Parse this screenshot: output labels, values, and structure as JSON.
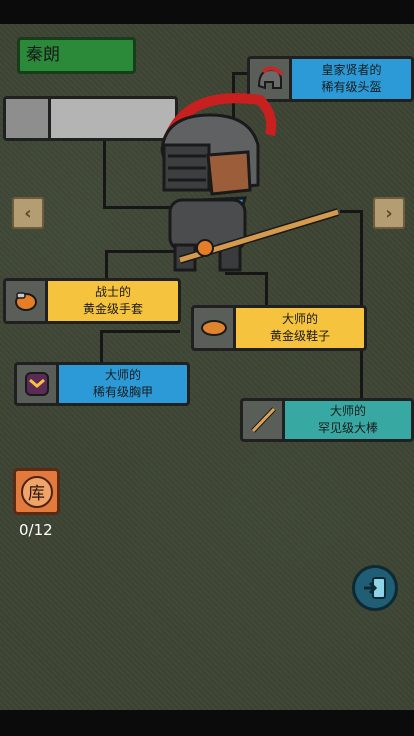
{
  "character": {
    "name": "秦朗"
  },
  "slots": {
    "helmet": {
      "line1": "皇家贤者的",
      "line2": "稀有级头盔",
      "icon": "helmet-icon",
      "color": "#2b9ad6"
    },
    "gloves": {
      "line1": "战士的",
      "line2": "黄金级手套",
      "icon": "gloves-icon",
      "color": "#f5c33d"
    },
    "shoes": {
      "line1": "大师的",
      "line2": "黄金级鞋子",
      "icon": "shoes-icon",
      "color": "#f5c33d"
    },
    "armor": {
      "line1": "大师的",
      "line2": "稀有级胸甲",
      "icon": "chest-armor-icon",
      "color": "#2b9ad6"
    },
    "weapon": {
      "line1": "大师的",
      "line2": "罕见级大棒",
      "icon": "staff-icon",
      "color": "#38a8a2"
    }
  },
  "inventory": {
    "button_label": "库",
    "count": "0/12"
  },
  "nav": {
    "prev_icon": "chevron-left-icon",
    "next_icon": "chevron-right-icon",
    "exit_icon": "exit-icon"
  }
}
